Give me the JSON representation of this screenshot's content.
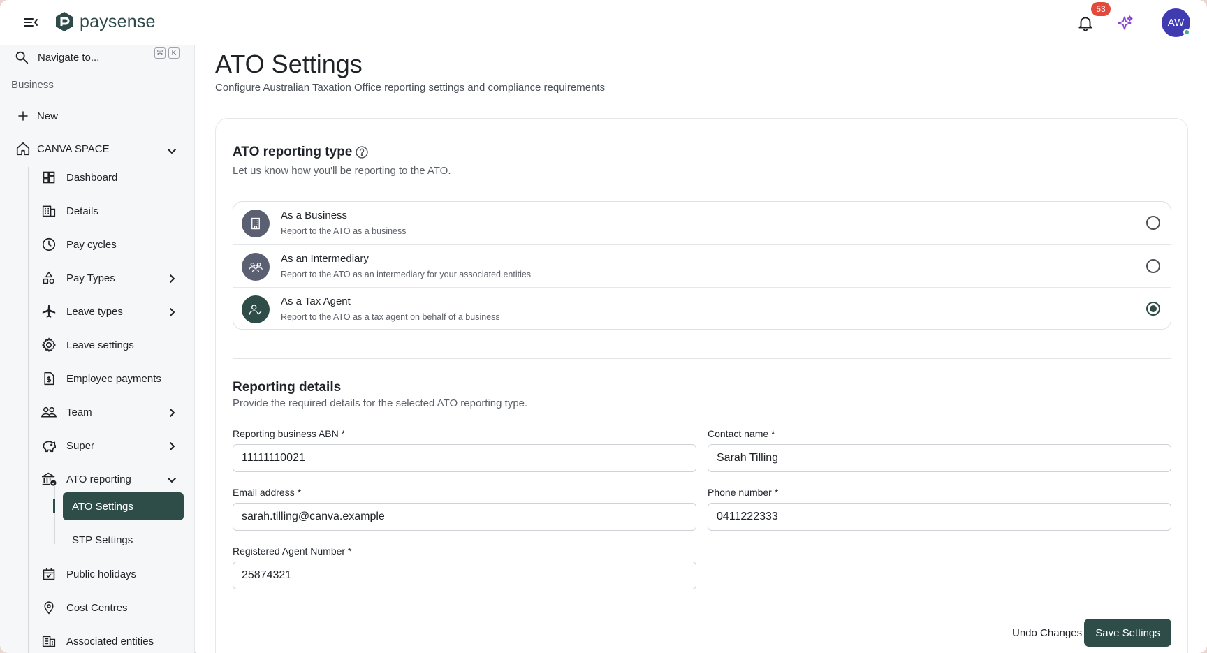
{
  "app": {
    "brand": "paysense",
    "notifications_count": "53",
    "avatar_initials": "AW",
    "accent_color": "#2f4d48",
    "avatar_color": "#3f3bb1",
    "badge_color": "#e24b3b"
  },
  "sidebar": {
    "search_label": "Navigate to...",
    "shortcut_keys": [
      "⌘",
      "K"
    ],
    "section_label": "Business",
    "new_label": "New",
    "workspace": "CANVA SPACE",
    "items": [
      {
        "label": "Dashboard",
        "icon": "dashboard-icon"
      },
      {
        "label": "Details",
        "icon": "building-icon"
      },
      {
        "label": "Pay cycles",
        "icon": "clock-icon"
      },
      {
        "label": "Pay Types",
        "icon": "shapes-icon"
      },
      {
        "label": "Leave types",
        "icon": "plane-icon"
      },
      {
        "label": "Leave settings",
        "icon": "gear-icon"
      },
      {
        "label": "Employee payments",
        "icon": "dollar-document-icon"
      },
      {
        "label": "Team",
        "icon": "team-icon"
      },
      {
        "label": "Super",
        "icon": "piggy-bank-icon"
      },
      {
        "label": "ATO reporting",
        "icon": "bank-check-icon"
      },
      {
        "label": "Public holidays",
        "icon": "calendar-check-icon"
      },
      {
        "label": "Cost Centres",
        "icon": "location-pin-icon"
      },
      {
        "label": "Associated entities",
        "icon": "buildings-icon"
      }
    ],
    "ato_sub_items": [
      {
        "label": "ATO Settings",
        "active": true
      },
      {
        "label": "STP Settings",
        "active": false
      }
    ]
  },
  "main": {
    "title": "ATO Settings",
    "subtitle": "Configure Australian Taxation Office reporting settings and compliance requirements",
    "reporting_type": {
      "title": "ATO reporting type",
      "subtitle": "Let us know how you'll be reporting to the ATO.",
      "options": [
        {
          "title": "As a Business",
          "desc": "Report to the ATO as a business",
          "selected": false
        },
        {
          "title": "As an Intermediary",
          "desc": "Report to the ATO as an intermediary for your associated entities",
          "selected": false
        },
        {
          "title": "As a Tax Agent",
          "desc": "Report to the ATO as a tax agent on behalf of a business",
          "selected": true
        }
      ]
    },
    "reporting_details": {
      "title": "Reporting details",
      "subtitle": "Provide the required details for the selected ATO reporting type.",
      "fields": {
        "abn": {
          "label": "Reporting business ABN *",
          "value": "11111110021"
        },
        "contact_name": {
          "label": "Contact name *",
          "value": "Sarah Tilling"
        },
        "email": {
          "label": "Email address *",
          "value": "sarah.tilling@canva.example"
        },
        "phone": {
          "label": "Phone number *",
          "value": "0411222333"
        },
        "agent_number": {
          "label": "Registered Agent Number *",
          "value": "25874321"
        }
      }
    },
    "actions": {
      "undo_label": "Undo Changes",
      "save_label": "Save Settings"
    }
  }
}
